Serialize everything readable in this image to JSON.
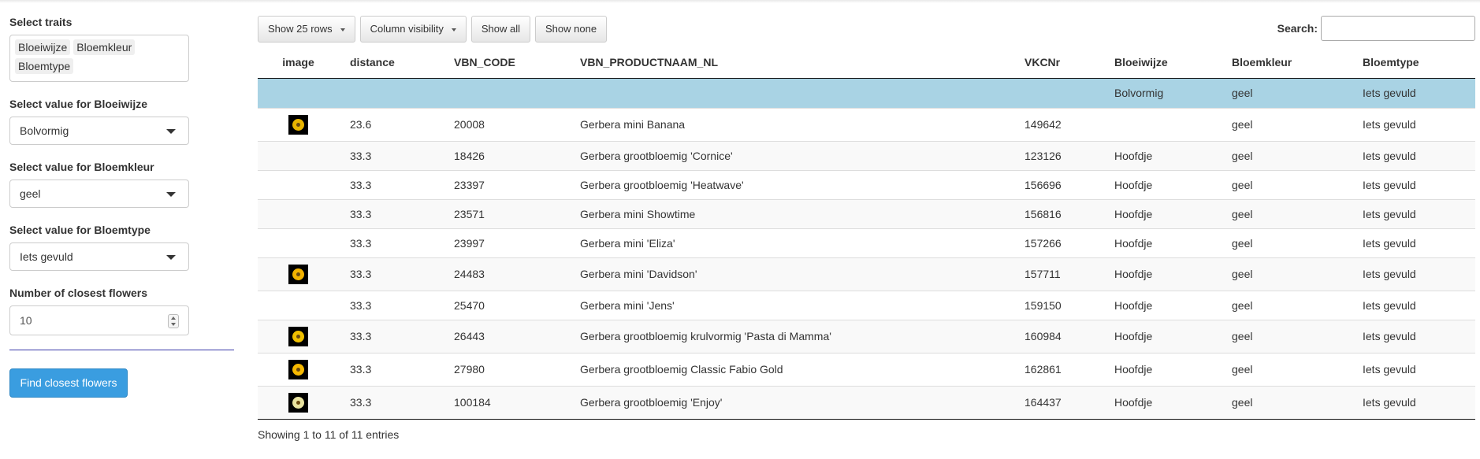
{
  "sidebar": {
    "select_traits_label": "Select traits",
    "selected_traits": [
      "Bloeiwijze",
      "Bloemkleur",
      "Bloemtype"
    ],
    "bloeiwijze_label": "Select value for Bloeiwijze",
    "bloeiwijze_value": "Bolvormig",
    "bloemkleur_label": "Select value for Bloemkleur",
    "bloemkleur_value": "geel",
    "bloemtype_label": "Select value for Bloemtype",
    "bloemtype_value": "Iets gevuld",
    "number_label": "Number of closest flowers",
    "number_value": "10",
    "find_button": "Find closest flowers"
  },
  "toolbar": {
    "show_rows": "Show 25 rows",
    "column_visibility": "Column visibility",
    "show_all": "Show all",
    "show_none": "Show none",
    "search_label": "Search:"
  },
  "table": {
    "headers": [
      "image",
      "distance",
      "VBN_CODE",
      "VBN_PRODUCTNAAM_NL",
      "VKCNr",
      "Bloeiwijze",
      "Bloemkleur",
      "Bloemtype"
    ],
    "query_row": [
      "",
      "",
      "",
      "",
      "",
      "Bolvormig",
      "geel",
      "Iets gevuld"
    ],
    "rows": [
      {
        "image": "flower-thumbnail",
        "thumb_color": "#e8b400",
        "distance": "23.6",
        "code": "20008",
        "name": "Gerbera mini Banana",
        "vkc": "149642",
        "bloeiwijze": "",
        "bloemkleur": "geel",
        "bloemtype": "Iets gevuld"
      },
      {
        "image": "",
        "thumb_color": "",
        "distance": "33.3",
        "code": "18426",
        "name": "Gerbera grootbloemig 'Cornice'",
        "vkc": "123126",
        "bloeiwijze": "Hoofdje",
        "bloemkleur": "geel",
        "bloemtype": "Iets gevuld"
      },
      {
        "image": "",
        "thumb_color": "",
        "distance": "33.3",
        "code": "23397",
        "name": "Gerbera grootbloemig 'Heatwave'",
        "vkc": "156696",
        "bloeiwijze": "Hoofdje",
        "bloemkleur": "geel",
        "bloemtype": "Iets gevuld"
      },
      {
        "image": "",
        "thumb_color": "",
        "distance": "33.3",
        "code": "23571",
        "name": "Gerbera mini Showtime",
        "vkc": "156816",
        "bloeiwijze": "Hoofdje",
        "bloemkleur": "geel",
        "bloemtype": "Iets gevuld"
      },
      {
        "image": "",
        "thumb_color": "",
        "distance": "33.3",
        "code": "23997",
        "name": "Gerbera mini 'Eliza'",
        "vkc": "157266",
        "bloeiwijze": "Hoofdje",
        "bloemkleur": "geel",
        "bloemtype": "Iets gevuld"
      },
      {
        "image": "flower-thumbnail",
        "thumb_color": "#f2b200",
        "distance": "33.3",
        "code": "24483",
        "name": "Gerbera mini 'Davidson'",
        "vkc": "157711",
        "bloeiwijze": "Hoofdje",
        "bloemkleur": "geel",
        "bloemtype": "Iets gevuld"
      },
      {
        "image": "",
        "thumb_color": "",
        "distance": "33.3",
        "code": "25470",
        "name": "Gerbera mini 'Jens'",
        "vkc": "159150",
        "bloeiwijze": "Hoofdje",
        "bloemkleur": "geel",
        "bloemtype": "Iets gevuld"
      },
      {
        "image": "flower-thumbnail",
        "thumb_color": "#f0c000",
        "distance": "33.3",
        "code": "26443",
        "name": "Gerbera grootbloemig krulvormig 'Pasta di Mamma'",
        "vkc": "160984",
        "bloeiwijze": "Hoofdje",
        "bloemkleur": "geel",
        "bloemtype": "Iets gevuld"
      },
      {
        "image": "flower-thumbnail",
        "thumb_color": "#f5b800",
        "distance": "33.3",
        "code": "27980",
        "name": "Gerbera grootbloemig Classic Fabio Gold",
        "vkc": "162861",
        "bloeiwijze": "Hoofdje",
        "bloemkleur": "geel",
        "bloemtype": "Iets gevuld"
      },
      {
        "image": "flower-thumbnail",
        "thumb_color": "#e9e3a0",
        "distance": "33.3",
        "code": "100184",
        "name": "Gerbera grootbloemig 'Enjoy'",
        "vkc": "164437",
        "bloeiwijze": "Hoofdje",
        "bloemkleur": "geel",
        "bloemtype": "Iets gevuld"
      }
    ],
    "info": "Showing 1 to 11 of 11 entries"
  },
  "colors": {
    "accent_button": "#3a9de0",
    "query_row_bg": "#a9d3e4",
    "divider": "#3a3aa8"
  }
}
